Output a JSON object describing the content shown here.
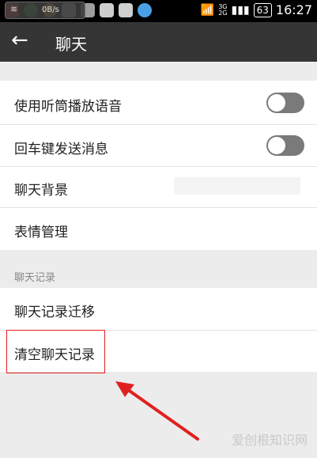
{
  "status_bar": {
    "signal_labels": [
      "3G",
      "2G"
    ],
    "battery": "63",
    "time": "16:27",
    "net_speed": "0B/s"
  },
  "app_bar": {
    "title": "聊天"
  },
  "settings": {
    "speaker_playback": {
      "label": "使用听筒播放语音",
      "on": false
    },
    "enter_to_send": {
      "label": "回车键发送消息",
      "on": false
    },
    "chat_background": {
      "label": "聊天背景"
    },
    "emoji_management": {
      "label": "表情管理"
    }
  },
  "chat_history": {
    "header": "聊天记录",
    "migrate": {
      "label": "聊天记录迁移"
    },
    "clear": {
      "label": "清空聊天记录"
    }
  },
  "annotation": {
    "color": "#e02020"
  },
  "watermark": "爱创根知识网",
  "colors": {
    "appbar": "#353535",
    "toggle_off": "#7a7a7a",
    "status_bar": "#000000"
  },
  "app_icons": [
    "qq-icon",
    "browser-icon",
    "sunflower-icon",
    "gallery-icon",
    "taurus-icon",
    "wechat-icon",
    "wechat-icon",
    "qq-browser-icon"
  ]
}
